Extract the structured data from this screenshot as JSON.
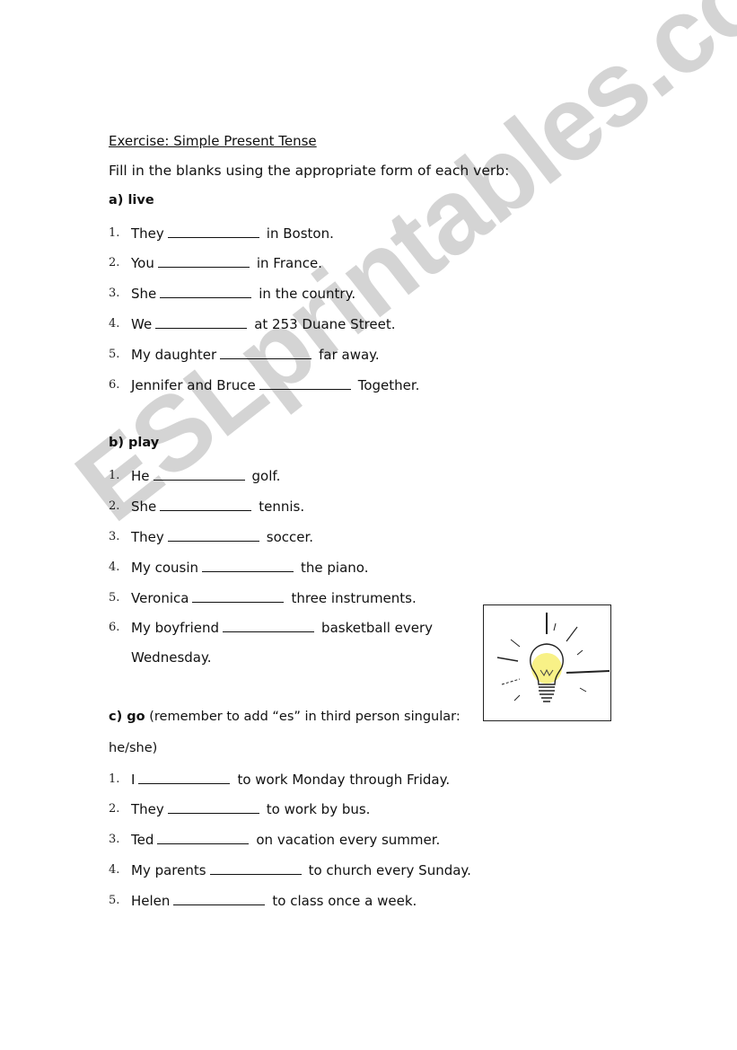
{
  "title": "Exercise: Simple Present Tense",
  "instruction": "Fill in the blanks using the appropriate form of each verb:",
  "sections": [
    {
      "label": "a)  live",
      "note": "",
      "items": [
        {
          "num": "1.",
          "before": "They",
          "after": "in Boston."
        },
        {
          "num": "2.",
          "before": "You",
          "after": "in France."
        },
        {
          "num": "3.",
          "before": "She",
          "after": "in the country."
        },
        {
          "num": "4.",
          "before": "We",
          "after": "at 253 Duane Street."
        },
        {
          "num": "5.",
          "before": "My daughter",
          "after": "far away."
        },
        {
          "num": "6.",
          "before": "Jennifer and Bruce",
          "after": "Together."
        }
      ]
    },
    {
      "label": "b)  play",
      "note": "",
      "items": [
        {
          "num": "1.",
          "before": "He",
          "after": "golf."
        },
        {
          "num": "2.",
          "before": "She",
          "after": "tennis."
        },
        {
          "num": "3.",
          "before": "They",
          "after": "soccer."
        },
        {
          "num": "4.",
          "before": "My cousin",
          "after": "the piano."
        },
        {
          "num": "5.",
          "before": "Veronica",
          "after": "three instruments."
        },
        {
          "num": "6.",
          "before": "My boyfriend",
          "after": "basketball every",
          "continuation": "Wednesday."
        }
      ]
    },
    {
      "label": "c)  go",
      "note": " (remember to add “es” in third person singular:",
      "note_continuation": "he/she)",
      "items": [
        {
          "num": "1.",
          "before": "I",
          "after": "to work Monday through Friday."
        },
        {
          "num": "2.",
          "before": "They",
          "after": "to work by bus."
        },
        {
          "num": "3.",
          "before": "Ted",
          "after": "on vacation every summer."
        },
        {
          "num": "4.",
          "before": "My parents",
          "after": "to church every Sunday."
        },
        {
          "num": "5.",
          "before": "Helen",
          "after": "to class once a week."
        }
      ]
    }
  ],
  "image": {
    "icon": "lightbulb-icon",
    "bulb_color": "#f7f07a"
  },
  "watermark": "ESLprintables.com"
}
